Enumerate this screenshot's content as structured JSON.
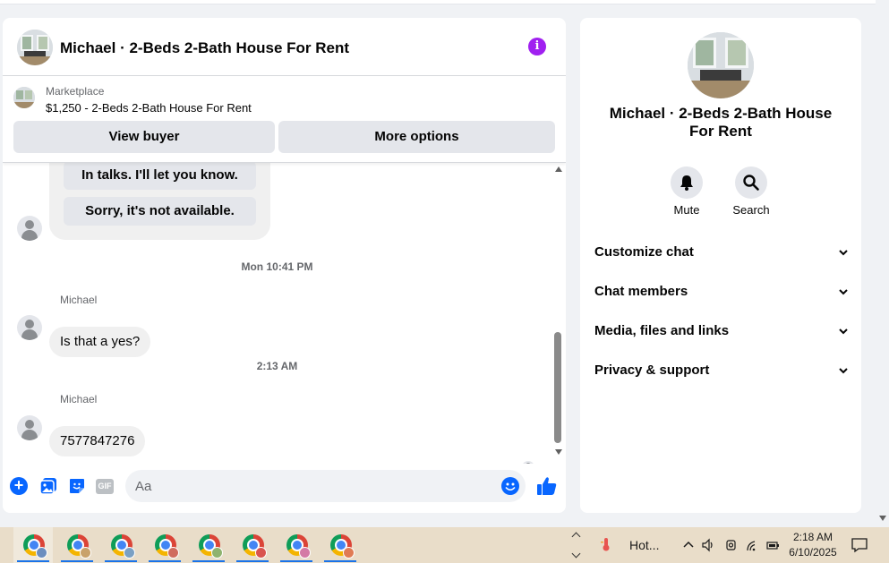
{
  "chat": {
    "title": "Michael · 2-Beds 2-Bath House For Rent",
    "listing": {
      "category": "Marketplace",
      "price_title": "$1,250 - 2-Beds 2-Bath House For Rent",
      "view_buyer_label": "View buyer",
      "more_options_label": "More options"
    },
    "quick_replies": [
      "In talks. I'll let you know.",
      "Sorry, it's not available."
    ],
    "timestamps": [
      "Mon 10:41 PM",
      "2:13 AM"
    ],
    "messages": [
      {
        "sender": "Michael",
        "text": "Is that a yes?"
      },
      {
        "sender": "Michael",
        "text": "7577847276"
      }
    ],
    "composer": {
      "placeholder": "Aa",
      "gif_label": "GIF"
    },
    "accent_color": "#0866ff",
    "info_color": "#a020f0"
  },
  "info_panel": {
    "title": "Michael · 2-Beds 2-Bath House For Rent",
    "actions": [
      {
        "icon": "bell-icon",
        "label": "Mute"
      },
      {
        "icon": "search-icon",
        "label": "Search"
      }
    ],
    "sections": [
      "Customize chat",
      "Chat members",
      "Media, files and links",
      "Privacy & support"
    ]
  },
  "taskbar": {
    "apps": [
      "chrome-icon",
      "chrome-icon",
      "chrome-icon",
      "chrome-icon",
      "chrome-icon",
      "chrome-icon",
      "chrome-icon",
      "chrome-icon"
    ],
    "weather_text": "Hot...",
    "time": "2:18 AM",
    "date": "6/10/2025"
  }
}
